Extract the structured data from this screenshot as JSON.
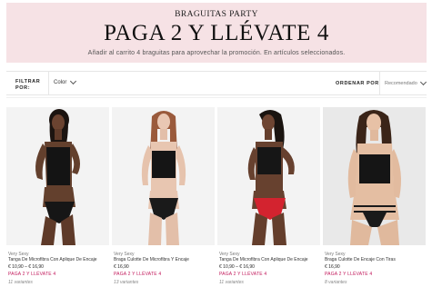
{
  "banner": {
    "eyebrow": "BRAGUITAS PARTY",
    "headline": "PAGA 2 Y LLÉVATE 4",
    "subtitle": "Añadir al carrito 4 braguitas para aprovechar la promoción. En artículos seleccionados."
  },
  "filters": {
    "label": "FILTRAR POR:",
    "color_dropdown": "Color",
    "order_label": "ORDENAR POR",
    "sort_value": "Recomendado"
  },
  "colors": {
    "banner_bg": "#f6e2e5",
    "promo": "#c2185b"
  },
  "products": [
    {
      "brand": "Very Sexy",
      "name": "Tanga De Microfibra Con Aplique De Encaje",
      "price": "€ 10,90 – € 16,90",
      "promo": "PAGA 2 Y LLÉVATE 4",
      "variants": "11 variantes"
    },
    {
      "brand": "Very Sexy",
      "name": "Braga Culotte De Microfibra Y Encaje",
      "price": "€ 16,90",
      "promo": "PAGA 2 Y LLÉVATE 4",
      "variants": "13 variantes"
    },
    {
      "brand": "Very Sexy",
      "name": "Tanga De Microfibra Con Aplique De Encaje",
      "price": "€ 10,90 – € 16,90",
      "promo": "PAGA 2 Y LLÉVATE 4",
      "variants": "11 variantes"
    },
    {
      "brand": "Very Sexy",
      "name": "Braga Culotte De Encaje Con Tiras",
      "price": "€ 16,90",
      "promo": "PAGA 2 Y LLÉVATE 4",
      "variants": "8 variantes"
    }
  ]
}
